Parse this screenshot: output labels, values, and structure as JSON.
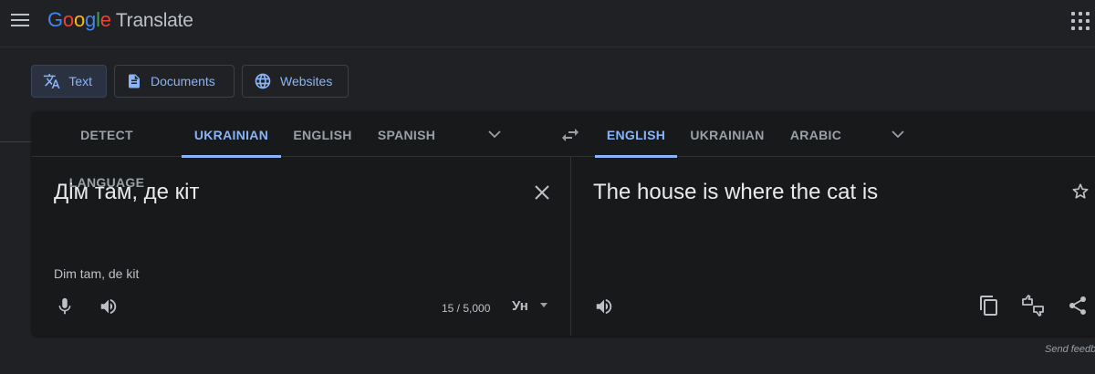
{
  "header": {
    "logo_word": "Google",
    "product_name": "Translate"
  },
  "modes": [
    {
      "label": "Text",
      "icon": "translate-icon",
      "active": true
    },
    {
      "label": "Documents",
      "icon": "document-icon",
      "active": false
    },
    {
      "label": "Websites",
      "icon": "globe-icon",
      "active": false
    }
  ],
  "source_languages": [
    "DETECT LANGUAGE",
    "UKRAINIAN",
    "ENGLISH",
    "SPANISH"
  ],
  "source_active": "UKRAINIAN",
  "target_languages": [
    "ENGLISH",
    "UKRAINIAN",
    "ARABIC"
  ],
  "target_active": "ENGLISH",
  "source": {
    "text": "Дім там, де кіт",
    "transliteration": "Dim tam, de kit",
    "char_count": "15 / 5,000",
    "ime_label": "Ун"
  },
  "target": {
    "text": "The house is where the cat is"
  },
  "footer": {
    "feedback": "Send feedback"
  },
  "colors": {
    "background": "#202124",
    "panel": "#18191b",
    "accent": "#8ab4f8"
  }
}
